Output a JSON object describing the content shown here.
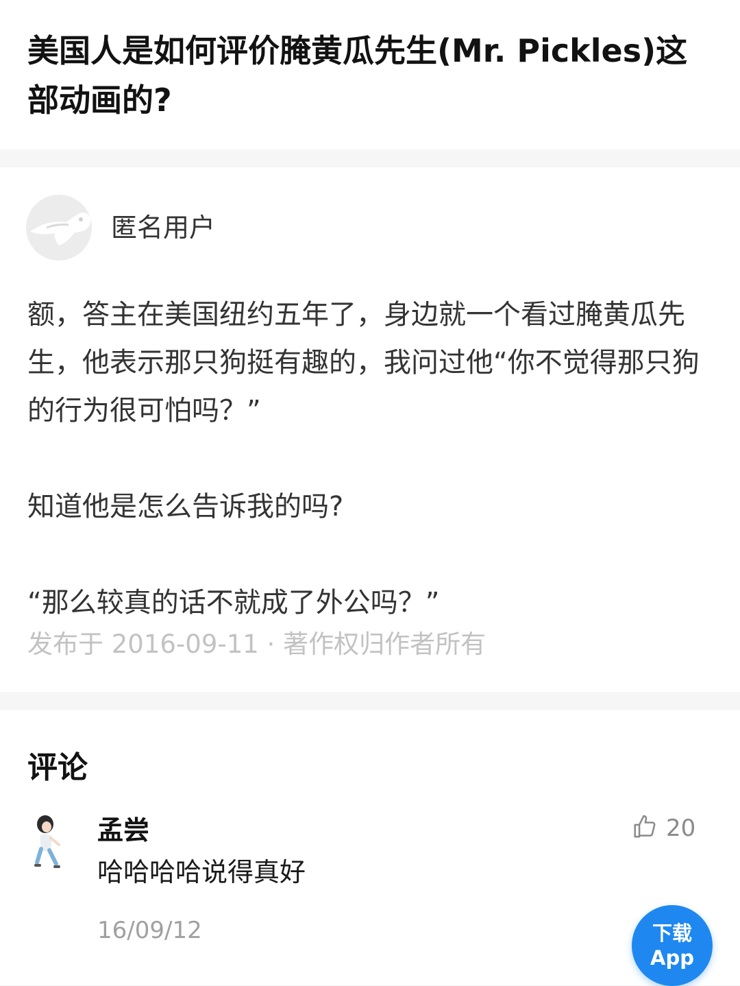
{
  "question": {
    "title": "美国人是如何评价腌黄瓜先生(Mr. Pickles)这部动画的?"
  },
  "answer": {
    "author_name": "匿名用户",
    "paragraphs": [
      "额，答主在美国纽约五年了，身边就一个看过腌黄瓜先生，他表示那只狗挺有趣的，我问过他“你不觉得那只狗的行为很可怕吗？”",
      "知道他是怎么告诉我的吗?",
      "“那么较真的话不就成了外公吗？”"
    ],
    "meta": "发布于 2016-09-11 · 著作权归作者所有"
  },
  "comments": {
    "title": "评论",
    "items": [
      {
        "user": "孟尝",
        "text": "哈哈哈哈说得真好",
        "date": "16/09/12",
        "likes": "20"
      }
    ]
  },
  "download_button": {
    "line1": "下载",
    "line2": "App"
  },
  "colors": {
    "accent": "#1e88f0",
    "page_background": "#f6f6f6",
    "meta_text": "#c2c2c2"
  },
  "icons": [
    "anonymous-avatar-icon",
    "user-avatar-icon",
    "thumbs-up-icon"
  ]
}
